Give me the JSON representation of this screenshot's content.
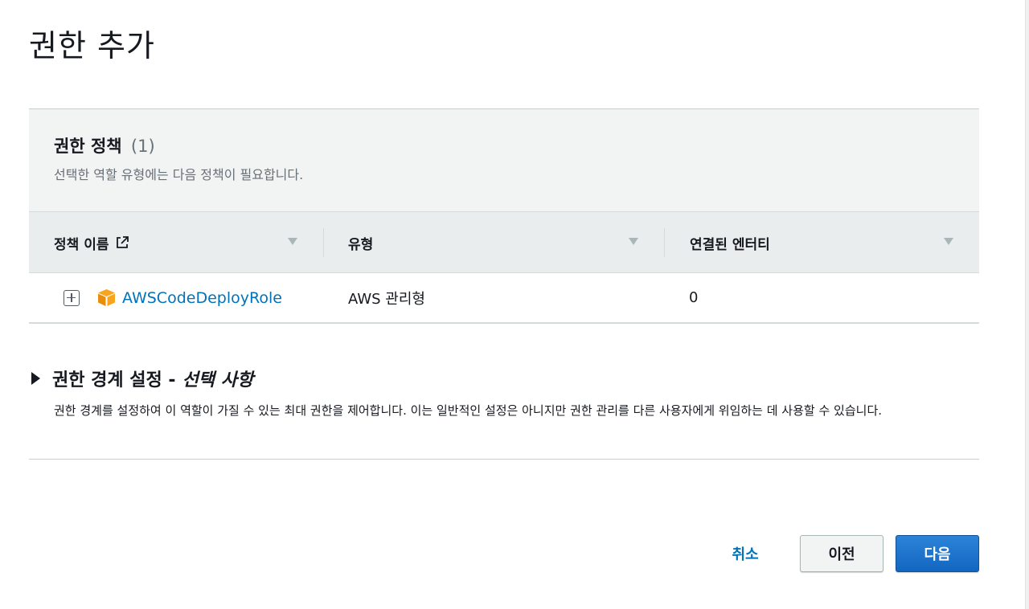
{
  "page": {
    "title": "권한 추가"
  },
  "policies": {
    "title": "권한 정책",
    "count": "(1)",
    "description": "선택한 역할 유형에는 다음 정책이 필요합니다.",
    "columns": {
      "name": "정책 이름",
      "type": "유형",
      "entities": "연결된 엔터티"
    },
    "rows": [
      {
        "name": "AWSCodeDeployRole",
        "type": "AWS 관리형",
        "entities": "0",
        "icon": "cube-icon"
      }
    ]
  },
  "boundary": {
    "title": "권한 경계 설정 -",
    "optional": "선택 사항",
    "description": "권한 경계를 설정하여 이 역할이 가질 수 있는 최대 권한을 제어합니다. 이는 일반적인 설정은 아니지만 권한 관리를 다른 사용자에게 위임하는 데 사용할 수 있습니다."
  },
  "buttons": {
    "cancel": "취소",
    "previous": "이전",
    "next": "다음"
  },
  "colors": {
    "link": "#0073bb",
    "primary": "#1f74cc",
    "policy_icon": "#f7a51e"
  }
}
